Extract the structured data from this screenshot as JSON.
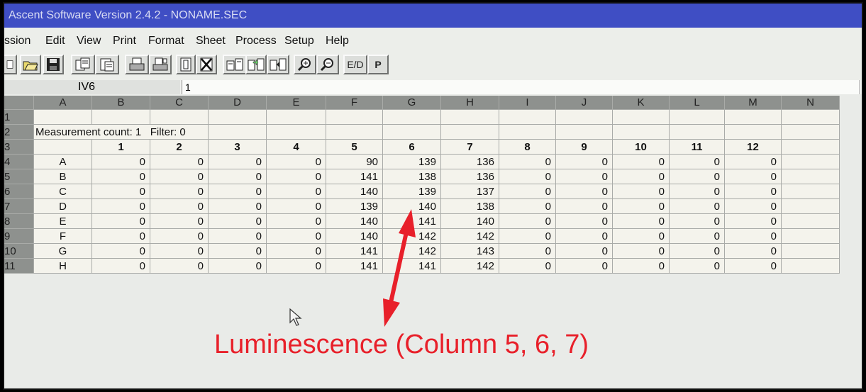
{
  "window": {
    "title": "Ascent Software Version 2.4.2 - NONAME.SEC"
  },
  "menu": [
    "ssion",
    "Edit",
    "View",
    "Print",
    "Format",
    "Sheet",
    "Process",
    "Setup",
    "Help"
  ],
  "toolbar": {
    "buttons": [
      {
        "icon": "new-icon"
      },
      {
        "icon": "open-icon"
      },
      {
        "icon": "save-icon"
      },
      {
        "icon": "copy-icon"
      },
      {
        "icon": "paste-icon"
      },
      {
        "icon": "print-icon"
      },
      {
        "icon": "print-preview-icon"
      },
      {
        "icon": "column-icon"
      },
      {
        "icon": "clear-icon"
      },
      {
        "icon": "plate-icon"
      },
      {
        "icon": "plate-transfer-icon"
      },
      {
        "icon": "plate-export-icon"
      },
      {
        "icon": "zoom-in-icon"
      },
      {
        "icon": "zoom-out-icon"
      },
      {
        "icon": "ed-icon",
        "label": "E/D"
      },
      {
        "icon": "p-icon",
        "label": "P"
      }
    ]
  },
  "formula_bar": {
    "cell_ref": "IV6",
    "value": "1"
  },
  "sheet": {
    "columns": [
      "A",
      "B",
      "C",
      "D",
      "E",
      "F",
      "G",
      "H",
      "I",
      "J",
      "K",
      "L",
      "M",
      "N"
    ],
    "rows": [
      "1",
      "2",
      "3",
      "4",
      "5",
      "6",
      "7",
      "8",
      "9",
      "10",
      "11"
    ],
    "measurement_label": "Measurement count: 1   Filter: 0",
    "well_columns": [
      "1",
      "2",
      "3",
      "4",
      "5",
      "6",
      "7",
      "8",
      "9",
      "10",
      "11",
      "12"
    ],
    "plate_rows": [
      {
        "label": "A",
        "values": [
          "0",
          "0",
          "0",
          "0",
          "90",
          "139",
          "136",
          "0",
          "0",
          "0",
          "0",
          "0"
        ]
      },
      {
        "label": "B",
        "values": [
          "0",
          "0",
          "0",
          "0",
          "141",
          "138",
          "136",
          "0",
          "0",
          "0",
          "0",
          "0"
        ]
      },
      {
        "label": "C",
        "values": [
          "0",
          "0",
          "0",
          "0",
          "140",
          "139",
          "137",
          "0",
          "0",
          "0",
          "0",
          "0"
        ]
      },
      {
        "label": "D",
        "values": [
          "0",
          "0",
          "0",
          "0",
          "139",
          "140",
          "138",
          "0",
          "0",
          "0",
          "0",
          "0"
        ]
      },
      {
        "label": "E",
        "values": [
          "0",
          "0",
          "0",
          "0",
          "140",
          "141",
          "140",
          "0",
          "0",
          "0",
          "0",
          "0"
        ]
      },
      {
        "label": "F",
        "values": [
          "0",
          "0",
          "0",
          "0",
          "140",
          "142",
          "142",
          "0",
          "0",
          "0",
          "0",
          "0"
        ]
      },
      {
        "label": "G",
        "values": [
          "0",
          "0",
          "0",
          "0",
          "141",
          "142",
          "143",
          "0",
          "0",
          "0",
          "0",
          "0"
        ]
      },
      {
        "label": "H",
        "values": [
          "0",
          "0",
          "0",
          "0",
          "141",
          "141",
          "142",
          "0",
          "0",
          "0",
          "0",
          "0"
        ]
      }
    ]
  },
  "annotation": {
    "text": "Luminescence (Column 5, 6, 7)",
    "color": "#e8202a"
  }
}
